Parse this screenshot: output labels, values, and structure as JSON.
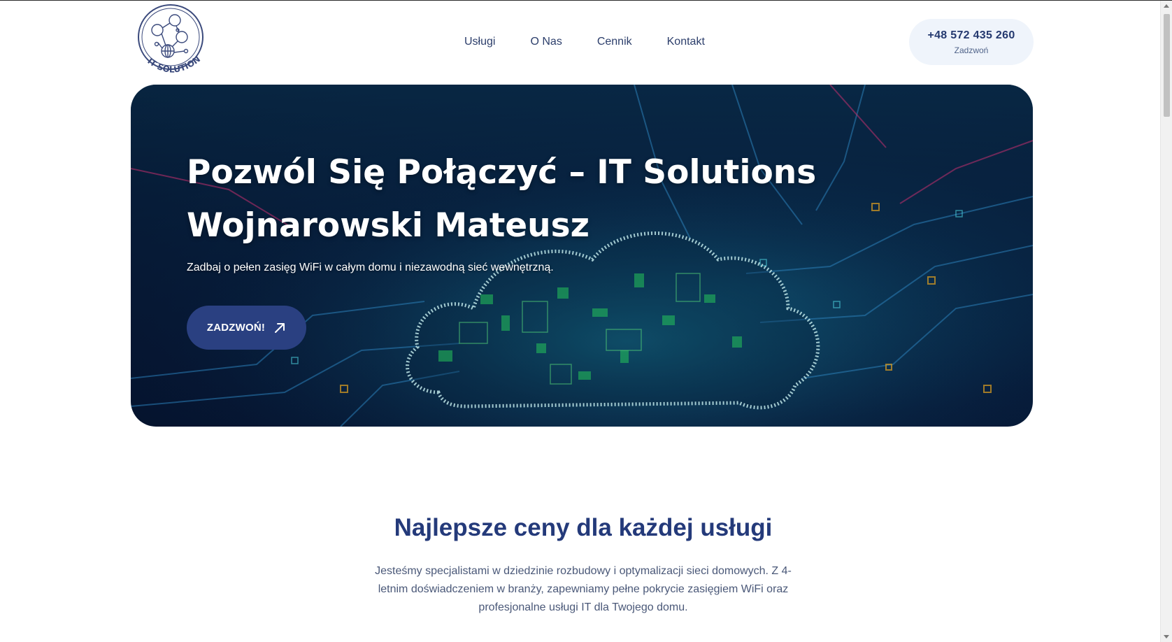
{
  "header": {
    "logo_text": "IT SOLUTIONS",
    "nav": [
      {
        "label": "Usługi"
      },
      {
        "label": "O Nas"
      },
      {
        "label": "Cennik"
      },
      {
        "label": "Kontakt"
      }
    ],
    "phone": {
      "number": "+48 572 435 260",
      "caption": "Zadzwoń"
    }
  },
  "hero": {
    "title": "Pozwól Się Połączyć – IT Solutions Wojnarowski Mateusz",
    "subtitle": "Zadbaj o pełen zasięg WiFi w całym domu i niezawodną sieć wewnętrzną.",
    "cta_label": "ZADZWOŃ!",
    "cta_icon": "arrow-up-right-icon"
  },
  "section": {
    "title": "Najlepsze ceny dla każdej usługi",
    "text": "Jesteśmy specjalistami w dziedzinie rozbudowy i optymalizacji sieci domowych. Z 4-letnim doświadczeniem w branży, zapewniamy pełne pokrycie zasięgiem WiFi oraz profesjonalne usługi IT dla Twojego domu."
  },
  "colors": {
    "brand": "#243a7a",
    "cta": "#2a4081",
    "pill": "#eff4fb"
  }
}
